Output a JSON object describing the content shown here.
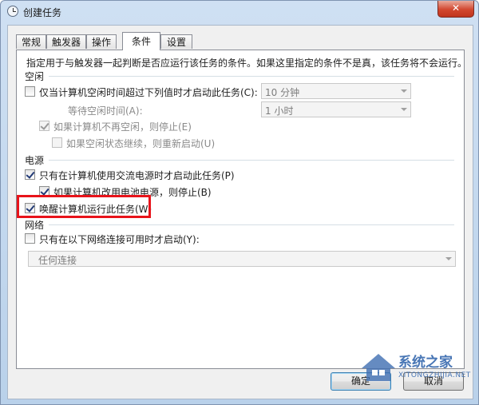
{
  "window": {
    "title": "创建任务",
    "close_label": "✕"
  },
  "tabs": [
    {
      "label": "常规",
      "active": false
    },
    {
      "label": "触发器",
      "active": false
    },
    {
      "label": "操作",
      "active": false
    },
    {
      "label": "条件",
      "active": true
    },
    {
      "label": "设置",
      "active": false
    }
  ],
  "description": "指定用于与触发器一起判断是否应运行该任务的条件。如果这里指定的条件不是真，该任务将不会运行。",
  "idle": {
    "group_label": "空闲",
    "start_only_if_idle": {
      "label": "仅当计算机空闲时间超过下列值时才启动此任务(C):",
      "checked": false,
      "combo_value": "10 分钟"
    },
    "wait_for_idle": {
      "label": "等待空闲时间(A):",
      "combo_value": "1 小时"
    },
    "stop_if_not_idle": {
      "label": "如果计算机不再空闲，则停止(E)",
      "checked": true
    },
    "restart_if_idle_resumes": {
      "label": "如果空闲状态继续，则重新启动(U)",
      "checked": false
    }
  },
  "power": {
    "group_label": "电源",
    "start_only_on_ac": {
      "label": "只有在计算机使用交流电源时才启动此任务(P)",
      "checked": true
    },
    "stop_on_battery": {
      "label": "如果计算机改用电池电源，则停止(B)",
      "checked": true
    },
    "wake_to_run": {
      "label": "唤醒计算机运行此任务(W)",
      "checked": true
    }
  },
  "network": {
    "group_label": "网络",
    "start_only_if_network": {
      "label": "只有在以下网络连接可用时才启动(Y):",
      "checked": false
    },
    "connection_combo": "任何连接"
  },
  "buttons": {
    "ok": "确定",
    "cancel": "取消"
  },
  "watermark": {
    "name": "系统之家",
    "site": "XITONGZHIJIA.NET"
  },
  "colors": {
    "highlight": "#e8131a",
    "titlebar": "#cfe0f3",
    "close": "#d2472f"
  }
}
